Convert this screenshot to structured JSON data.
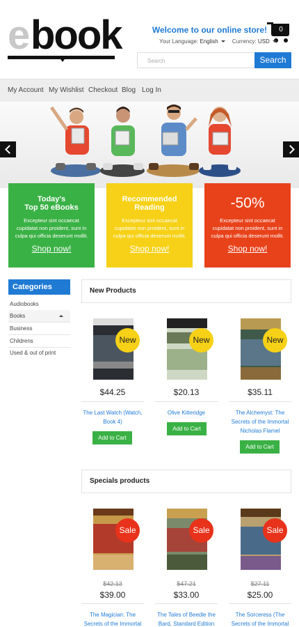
{
  "header": {
    "logo_e": "e",
    "logo_book": "book",
    "welcome": "Welcome to our online store!",
    "cart_count": "0",
    "language_label": "Your Language:",
    "language_value": "English",
    "currency_label": "Currency:",
    "currency_value": "USD",
    "search_placeholder": "Search",
    "search_button": "Search"
  },
  "nav": {
    "items": [
      "My Account",
      "My Wishlist",
      "Checkout",
      "Blog",
      "Log In"
    ]
  },
  "banner": {
    "prev_icon": "chevron-left-icon",
    "next_icon": "chevron-right-icon"
  },
  "promos": [
    {
      "title_line1": "Today's",
      "title_line2": "Top 50 eBooks",
      "text": "Excepteur sint occaecat cupidatat non proident, sunt in culpa qui officia deserunt mollit.",
      "cta": "Shop now!",
      "color": "#3ab145"
    },
    {
      "title_line1": "Recommended",
      "title_line2": "Reading",
      "text": "Excepteur sint occaecat cupidatat non proident, sunt in culpa qui officia deserunt mollit.",
      "cta": "Shop now!",
      "color": "#f6d117"
    },
    {
      "title": "-50%",
      "text": "Excepteur sint occaecat cupidatat non proident, sunt in culpa qui officia deserunt mollit.",
      "cta": "Shop now!",
      "color": "#e8421b"
    }
  ],
  "sidebar": {
    "title": "Categories",
    "items": [
      "Audiobooks",
      "Books",
      "Business",
      "Childrens",
      "Used & out of print"
    ]
  },
  "new_products": {
    "title": "New Products",
    "badge": "New",
    "add_label": "Add to Cart",
    "items": [
      {
        "price": "$44.25",
        "name_line1": "The Last Watch (Watch,",
        "name_line2": "Book 4)",
        "name_line3": ""
      },
      {
        "price": "$20.13",
        "name_line1": "Olive Kitteridge",
        "name_line2": "",
        "name_line3": ""
      },
      {
        "price": "$35.11",
        "name_line1": "The Alchemyst: The",
        "name_line2": "Secrets of the Immortal",
        "name_line3": "Nicholas Flamel"
      }
    ]
  },
  "specials": {
    "title": "Specials products",
    "badge": "Sale",
    "items": [
      {
        "old_price": "$42.13",
        "price": "$39.00",
        "name_line1": "The Magician: The",
        "name_line2": "Secrets of the Immortal"
      },
      {
        "old_price": "$47.21",
        "price": "$33.00",
        "name_line1": "The Tales of Beedle the",
        "name_line2": "Bard, Standard Edition"
      },
      {
        "old_price": "$27.11",
        "price": "$25.00",
        "name_line1": "The Sorceress (The",
        "name_line2": "Secrets of the Immortal"
      }
    ]
  },
  "colors": {
    "accent_blue": "#1f7ad4",
    "green": "#3ab145",
    "yellow": "#f6d117",
    "red": "#e8421b"
  }
}
